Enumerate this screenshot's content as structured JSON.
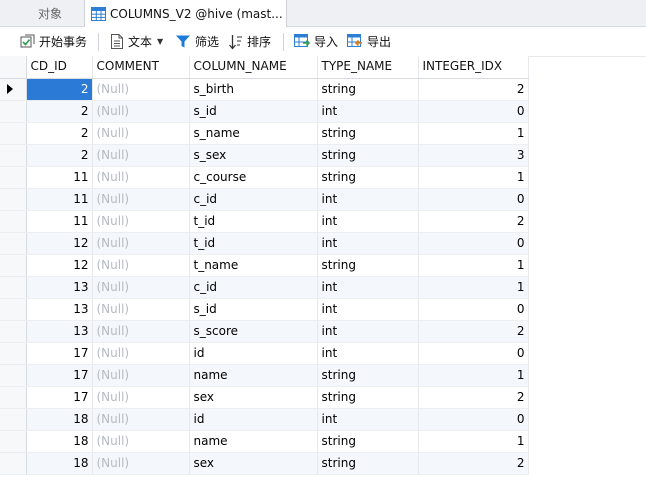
{
  "tabs": [
    {
      "label": "对象"
    },
    {
      "label": "COLUMNS_V2 @hive (mast..."
    }
  ],
  "toolbar": {
    "begin_transaction": "开始事务",
    "text": "文本",
    "filter": "筛选",
    "sort": "排序",
    "import": "导入",
    "export": "导出"
  },
  "columns": [
    "CD_ID",
    "COMMENT",
    "COLUMN_NAME",
    "TYPE_NAME",
    "INTEGER_IDX"
  ],
  "rows": [
    {
      "cd_id": "2",
      "comment": "(Null)",
      "column_name": "s_birth",
      "type_name": "string",
      "integer_idx": "2"
    },
    {
      "cd_id": "2",
      "comment": "(Null)",
      "column_name": "s_id",
      "type_name": "int",
      "integer_idx": "0"
    },
    {
      "cd_id": "2",
      "comment": "(Null)",
      "column_name": "s_name",
      "type_name": "string",
      "integer_idx": "1"
    },
    {
      "cd_id": "2",
      "comment": "(Null)",
      "column_name": "s_sex",
      "type_name": "string",
      "integer_idx": "3"
    },
    {
      "cd_id": "11",
      "comment": "(Null)",
      "column_name": "c_course",
      "type_name": "string",
      "integer_idx": "1"
    },
    {
      "cd_id": "11",
      "comment": "(Null)",
      "column_name": "c_id",
      "type_name": "int",
      "integer_idx": "0"
    },
    {
      "cd_id": "11",
      "comment": "(Null)",
      "column_name": "t_id",
      "type_name": "int",
      "integer_idx": "2"
    },
    {
      "cd_id": "12",
      "comment": "(Null)",
      "column_name": "t_id",
      "type_name": "int",
      "integer_idx": "0"
    },
    {
      "cd_id": "12",
      "comment": "(Null)",
      "column_name": "t_name",
      "type_name": "string",
      "integer_idx": "1"
    },
    {
      "cd_id": "13",
      "comment": "(Null)",
      "column_name": "c_id",
      "type_name": "int",
      "integer_idx": "1"
    },
    {
      "cd_id": "13",
      "comment": "(Null)",
      "column_name": "s_id",
      "type_name": "int",
      "integer_idx": "0"
    },
    {
      "cd_id": "13",
      "comment": "(Null)",
      "column_name": "s_score",
      "type_name": "int",
      "integer_idx": "2"
    },
    {
      "cd_id": "17",
      "comment": "(Null)",
      "column_name": "id",
      "type_name": "int",
      "integer_idx": "0"
    },
    {
      "cd_id": "17",
      "comment": "(Null)",
      "column_name": "name",
      "type_name": "string",
      "integer_idx": "1"
    },
    {
      "cd_id": "17",
      "comment": "(Null)",
      "column_name": "sex",
      "type_name": "string",
      "integer_idx": "2"
    },
    {
      "cd_id": "18",
      "comment": "(Null)",
      "column_name": "id",
      "type_name": "int",
      "integer_idx": "0"
    },
    {
      "cd_id": "18",
      "comment": "(Null)",
      "column_name": "name",
      "type_name": "string",
      "integer_idx": "1"
    },
    {
      "cd_id": "18",
      "comment": "(Null)",
      "column_name": "sex",
      "type_name": "string",
      "integer_idx": "2"
    }
  ],
  "selected_row": 0,
  "colors": {
    "selection": "#2a7ad6",
    "null_text": "#b7bbc0",
    "alt_row": "#f4f8fc",
    "icon_blue": "#1f7bd8",
    "icon_green": "#2e9d4e"
  }
}
